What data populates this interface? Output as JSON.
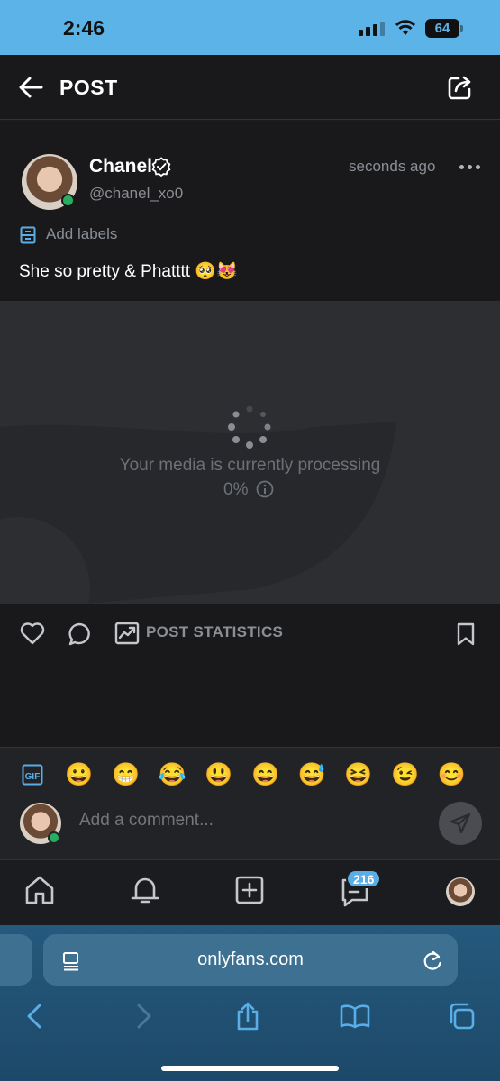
{
  "status_bar": {
    "time": "2:46",
    "battery": "64"
  },
  "header": {
    "title": "POST"
  },
  "post": {
    "author": "Chanel",
    "handle": "@chanel_xo0",
    "timestamp": "seconds ago",
    "labels_action": "Add labels",
    "text": "She so pretty & Phatttt 🥺😻"
  },
  "media": {
    "processing_text": "Your media is currently processing",
    "progress": "0%"
  },
  "actions": {
    "stats_label": "POST STATISTICS"
  },
  "comment": {
    "emojis": [
      "😀",
      "😁",
      "😂",
      "😃",
      "😄",
      "😅",
      "😆",
      "😉",
      "😊"
    ],
    "placeholder": "Add a comment..."
  },
  "nav": {
    "messages_badge": "216"
  },
  "browser": {
    "url": "onlyfans.com"
  },
  "colors": {
    "accent": "#5aaee8",
    "online": "#27ae60",
    "status_bar": "#5cb3e8"
  }
}
